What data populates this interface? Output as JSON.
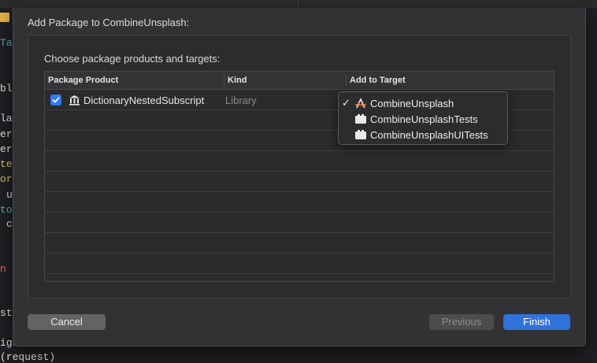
{
  "background": {
    "code_fragments": [
      "Ta",
      "bl",
      "la",
      "er",
      "er",
      "te",
      "or",
      "u",
      "to",
      "c",
      "n",
      "st",
      "igh",
      "(request)"
    ]
  },
  "dialog": {
    "title": "Add Package to CombineUnsplash:",
    "subtitle": "Choose package products and targets:",
    "columns": [
      "Package Product",
      "Kind",
      "Add to Target"
    ],
    "rows": [
      {
        "checked": true,
        "icon": "library-building-icon",
        "product": "DictionaryNestedSubscript",
        "kind": "Library"
      }
    ],
    "target_menu": {
      "items": [
        {
          "label": "CombineUnsplash",
          "checked": true,
          "icon": "app-target-icon"
        },
        {
          "label": "CombineUnsplashTests",
          "checked": false,
          "icon": "test-bundle-icon"
        },
        {
          "label": "CombineUnsplashUITests",
          "checked": false,
          "icon": "test-bundle-icon"
        }
      ],
      "checkmark": "✓"
    },
    "buttons": {
      "cancel": "Cancel",
      "previous": "Previous",
      "finish": "Finish"
    }
  },
  "colors": {
    "accent": "#2f72db",
    "checkbox": "#2f7bf6",
    "sheet_bg": "#323235"
  }
}
